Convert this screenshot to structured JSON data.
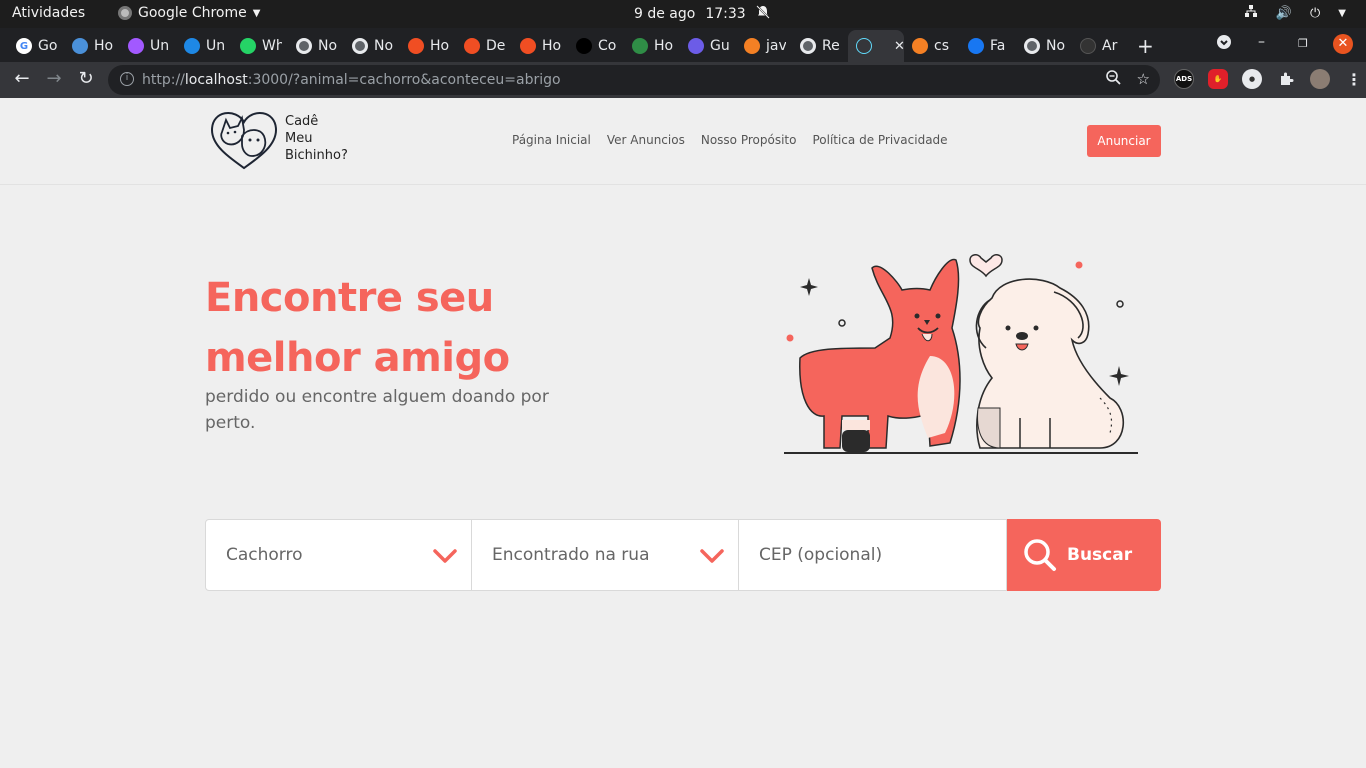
{
  "os_bar": {
    "activities": "Atividades",
    "app_name": "Google Chrome",
    "date": "9 de ago",
    "time": "17:33"
  },
  "tabs": [
    {
      "label": "Go",
      "icon": "google-icon",
      "color": "#ffffff"
    },
    {
      "label": "Ho",
      "icon": "app-icon",
      "color": "#4a90d9"
    },
    {
      "label": "Un",
      "icon": "figma-icon",
      "color": "#a259ff"
    },
    {
      "label": "Un",
      "icon": "app-icon",
      "color": "#1e88e5"
    },
    {
      "label": "Wh",
      "icon": "whatsapp-icon",
      "color": "#25d366"
    },
    {
      "label": "No",
      "icon": "chrome-icon",
      "color": "#9aa0a6"
    },
    {
      "label": "No",
      "icon": "chrome-icon",
      "color": "#9aa0a6"
    },
    {
      "label": "Ho",
      "icon": "hotmart-icon",
      "color": "#f04e23"
    },
    {
      "label": "De",
      "icon": "hotmart-icon",
      "color": "#f04e23"
    },
    {
      "label": "Ho",
      "icon": "hotmart-icon",
      "color": "#f04e23"
    },
    {
      "label": "Co",
      "icon": "medium-icon",
      "color": "#000000"
    },
    {
      "label": "Ho",
      "icon": "geeks-icon",
      "color": "#2f8d46"
    },
    {
      "label": "Gu",
      "icon": "h-icon",
      "color": "#6c5ce7"
    },
    {
      "label": "jav",
      "icon": "stackoverflow-icon",
      "color": "#f48024"
    },
    {
      "label": "Re",
      "icon": "chrome-icon",
      "color": "#9aa0a6"
    },
    {
      "label": "",
      "icon": "react-icon",
      "color": "#61dafb",
      "active": true
    },
    {
      "label": "cs",
      "icon": "stackoverflow-icon",
      "color": "#f48024"
    },
    {
      "label": "Fa",
      "icon": "facebook-icon",
      "color": "#1877f2"
    },
    {
      "label": "No",
      "icon": "chrome-icon",
      "color": "#9aa0a6"
    },
    {
      "label": "Ar",
      "icon": "github-icon",
      "color": "#333333"
    }
  ],
  "toolbar": {
    "url_prefix": "http://",
    "url_host": "localhost",
    "url_rest": ":3000/?animal=cachorro&aconteceu=abrigo",
    "ext_ads": "ADS"
  },
  "site": {
    "logo_line1": "Cadê",
    "logo_line2": "Meu",
    "logo_line3": "Bichinho?",
    "nav": [
      "Página Inicial",
      "Ver Anuncios",
      "Nosso Propósito",
      "Política de Privacidade"
    ],
    "cta": "Anunciar",
    "accent": "#f5655c"
  },
  "hero": {
    "title_line1": "Encontre seu",
    "title_line2": "melhor amigo",
    "subtitle": "perdido ou encontre alguem doando por perto."
  },
  "search": {
    "animal_selected": "Cachorro",
    "situation_selected": "Encontrado na rua",
    "cep_placeholder": "CEP (opcional)",
    "button": "Buscar"
  }
}
